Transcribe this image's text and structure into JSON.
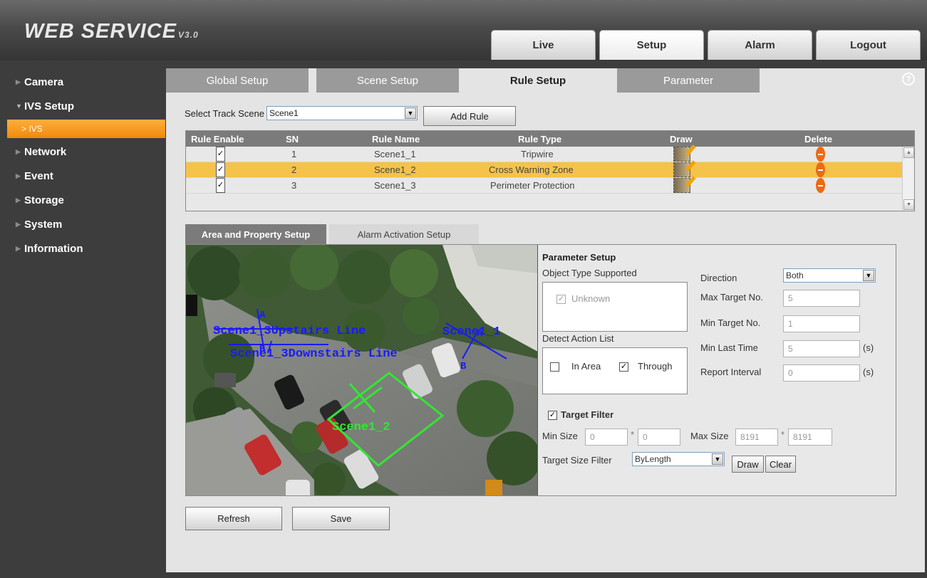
{
  "header": {
    "logo": "WEB  SERVICE",
    "version": "V3.0"
  },
  "topnav": [
    {
      "label": "Live"
    },
    {
      "label": "Setup"
    },
    {
      "label": "Alarm"
    },
    {
      "label": "Logout"
    }
  ],
  "sidebar": {
    "items": [
      {
        "label": "Camera"
      },
      {
        "label": "IVS Setup"
      },
      {
        "label": "> IVS"
      },
      {
        "label": "Network"
      },
      {
        "label": "Event"
      },
      {
        "label": "Storage"
      },
      {
        "label": "System"
      },
      {
        "label": "Information"
      }
    ]
  },
  "subtabs": [
    {
      "label": "Global Setup"
    },
    {
      "label": "Scene Setup"
    },
    {
      "label": "Rule Setup"
    },
    {
      "label": "Parameter"
    }
  ],
  "help_glyph": "?",
  "scene_select": {
    "label": "Select Track Scene",
    "value": "Scene1",
    "add_rule": "Add Rule"
  },
  "rule_table": {
    "headers": [
      "Rule Enable",
      "SN",
      "Rule Name",
      "Rule Type",
      "Draw",
      "Delete"
    ],
    "rows": [
      {
        "sn": "1",
        "name": "Scene1_1",
        "type": "Tripwire",
        "enabled": true
      },
      {
        "sn": "2",
        "name": "Scene1_2",
        "type": "Cross Warning Zone",
        "enabled": true
      },
      {
        "sn": "3",
        "name": "Scene1_3",
        "type": "Perimeter Protection",
        "enabled": true
      }
    ]
  },
  "lower_tabs": [
    {
      "label": "Area and Property Setup"
    },
    {
      "label": "Alarm Activation Setup"
    }
  ],
  "video_overlay": {
    "line1": "Scene1_3Upstairs Line",
    "line2": "Scene1_3Downstairs Line",
    "tripwire": "Scene1_1",
    "zone": "Scene1_2",
    "mark_a": "A",
    "mark_b": "B",
    "mark_a2": "A",
    "mark_b2": "B"
  },
  "params": {
    "title": "Parameter Setup",
    "object_type_label": "Object Type Supported",
    "object_type_option": "Unknown",
    "detect_action_label": "Detect Action List",
    "action_in_area": "In Area",
    "action_through": "Through",
    "direction_label": "Direction",
    "direction_value": "Both",
    "max_target_label": "Max Target No.",
    "max_target_value": "5",
    "min_target_label": "Min Target No.",
    "min_target_value": "1",
    "min_last_time_label": "Min Last Time",
    "min_last_time_value": "5",
    "report_interval_label": "Report Interval",
    "report_interval_value": "0",
    "unit_s": "(s)",
    "target_filter_label": "Target Filter",
    "min_size_label": "Min Size",
    "min_size_w": "0",
    "min_size_h": "0",
    "max_size_label": "Max Size",
    "max_size_w": "8191",
    "max_size_h": "8191",
    "times": "*",
    "target_size_filter_label": "Target Size Filter",
    "target_size_filter_value": "ByLength",
    "draw": "Draw",
    "clear": "Clear"
  },
  "actions": {
    "refresh": "Refresh",
    "save": "Save"
  },
  "checkmark": "✓",
  "colors": {
    "accent": "#f5c34a",
    "sidebar_active": "#f39417",
    "overlay_blue": "#1a1aff",
    "overlay_green": "#33e633"
  }
}
